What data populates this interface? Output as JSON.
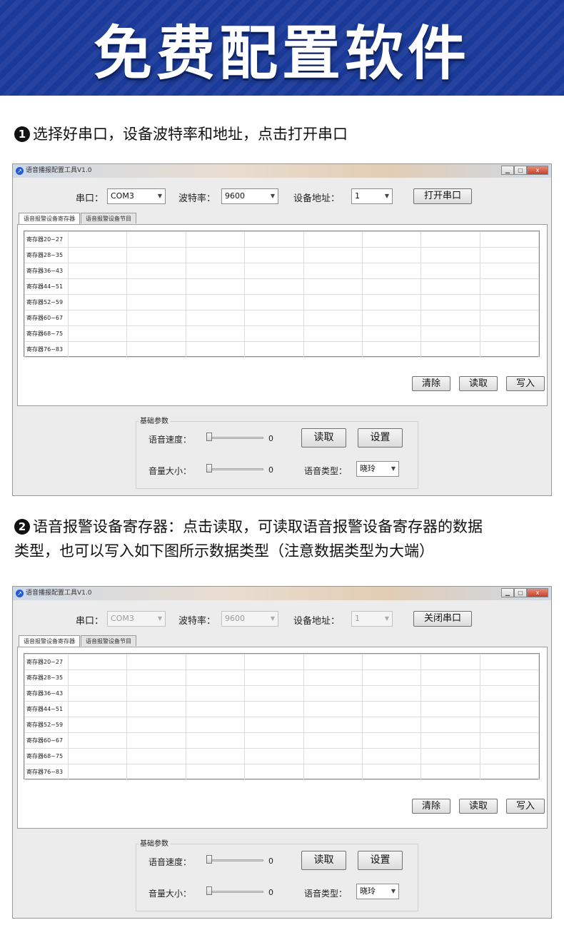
{
  "banner": {
    "title": "免费配置软件"
  },
  "step1": {
    "num": "1",
    "text": "选择好串口，设备波特率和地址，点击打开串口"
  },
  "step2": {
    "num": "2",
    "line1": "语音报警设备寄存器：点击读取，可读取语音报警设备寄存器的数据",
    "line2": "类型，也可以写入如下图所示数据类型（注意数据类型为大端）"
  },
  "windows": [
    {
      "title": "语音播报配置工具V1.0",
      "port_label": "串口：",
      "port_value": "COM3",
      "baud_label": "波特率：",
      "baud_value": "9600",
      "addr_label": "设备地址：",
      "addr_value": "1",
      "open_button": "打开串口",
      "tab_registers": "语音报警设备寄存器",
      "tab_programs": "语音报警设备节目",
      "rows": [
        "寄存器20~27",
        "寄存器28~35",
        "寄存器36~43",
        "寄存器44~51",
        "寄存器52~59",
        "寄存器60~67",
        "寄存器68~75",
        "寄存器76~83"
      ],
      "clear_button": "清除",
      "read_button": "读取",
      "write_button": "写入",
      "group_title": "基础参数",
      "speed_label": "语音速度：",
      "speed_value": "0",
      "volume_label": "音量大小：",
      "volume_value": "0",
      "param_read_button": "读取",
      "param_set_button": "设置",
      "voice_type_label": "语音类型：",
      "voice_type_value": "晓玲",
      "min_btn": "▁",
      "max_btn": "□",
      "close_btn": "x"
    },
    {
      "title": "语音播报配置工具V1.0",
      "port_label": "串口：",
      "port_value": "COM3",
      "baud_label": "波特率：",
      "baud_value": "9600",
      "addr_label": "设备地址：",
      "addr_value": "1",
      "open_button": "关闭串口",
      "tab_registers": "语音报警设备寄存器",
      "tab_programs": "语音报警设备节目",
      "rows": [
        "寄存器20~27",
        "寄存器28~35",
        "寄存器36~43",
        "寄存器44~51",
        "寄存器52~59",
        "寄存器60~67",
        "寄存器68~75",
        "寄存器76~83"
      ],
      "clear_button": "清除",
      "read_button": "读取",
      "write_button": "写入",
      "group_title": "基础参数",
      "speed_label": "语音速度：",
      "speed_value": "0",
      "volume_label": "音量大小：",
      "volume_value": "0",
      "param_read_button": "读取",
      "param_set_button": "设置",
      "voice_type_label": "语音类型：",
      "voice_type_value": "晓玲",
      "min_btn": "▁",
      "max_btn": "□",
      "close_btn": "x"
    }
  ],
  "colors": {
    "banner": "#1a3a9a",
    "window_bg": "#ececec"
  }
}
